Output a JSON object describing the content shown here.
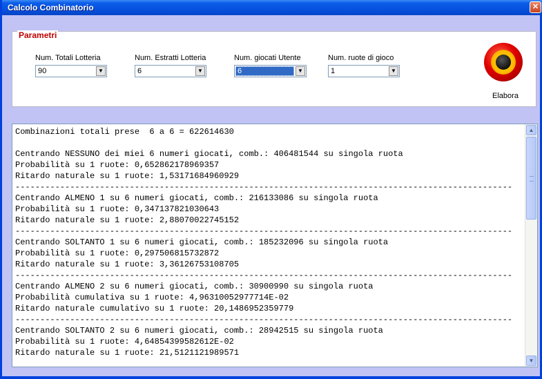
{
  "window": {
    "title": "Calcolo Combinatorio",
    "close_glyph": "✕"
  },
  "params": {
    "legend": "Parametri",
    "fields": [
      {
        "label": "Num. Totali Lotteria",
        "value": "90"
      },
      {
        "label": "Num. Estratti Lotteria",
        "value": "6"
      },
      {
        "label": "Num. giocati Utente",
        "value": "6"
      },
      {
        "label": "Num. ruote di gioco",
        "value": "1"
      }
    ],
    "run_label": "Elabora",
    "dropdown_glyph": "▼"
  },
  "output": {
    "lines": [
      "Combinazioni totali prese  6 a 6 = 622614630",
      "",
      "Centrando NESSUNO dei miei 6 numeri giocati, comb.: 406481544 su singola ruota",
      "Probabilità su 1 ruote: 0,652862178969357",
      "Ritardo naturale su 1 ruote: 1,53171684960929",
      "----------------------------------------------------------------------------------------------------",
      "Centrando ALMENO 1 su 6 numeri giocati, comb.: 216133086 su singola ruota",
      "Probabilità su 1 ruote: 0,347137821030643",
      "Ritardo naturale su 1 ruote: 2,88070022745152",
      "----------------------------------------------------------------------------------------------------",
      "Centrando SOLTANTO 1 su 6 numeri giocati, comb.: 185232096 su singola ruota",
      "Probabilità su 1 ruote: 0,297506815732872",
      "Ritardo naturale su 1 ruote: 3,36126753108705",
      "----------------------------------------------------------------------------------------------------",
      "Centrando ALMENO 2 su 6 numeri giocati, comb.: 30900990 su singola ruota",
      "Probabilità cumulativa su 1 ruote: 4,96310052977714E-02",
      "Ritardo naturale cumulativo su 1 ruote: 20,1486952359779",
      "----------------------------------------------------------------------------------------------------",
      "Centrando SOLTANTO 2 su 6 numeri giocati, comb.: 28942515 su singola ruota",
      "Probabilità su 1 ruote: 4,64854399582612E-02",
      "Ritardo naturale su 1 ruote: 21,5121121989571"
    ],
    "scroll_up_glyph": "▲",
    "scroll_down_glyph": "▼"
  },
  "icons": {
    "close": "close-icon",
    "dropdown": "chevron-down-icon",
    "run": "record-button-icon"
  }
}
